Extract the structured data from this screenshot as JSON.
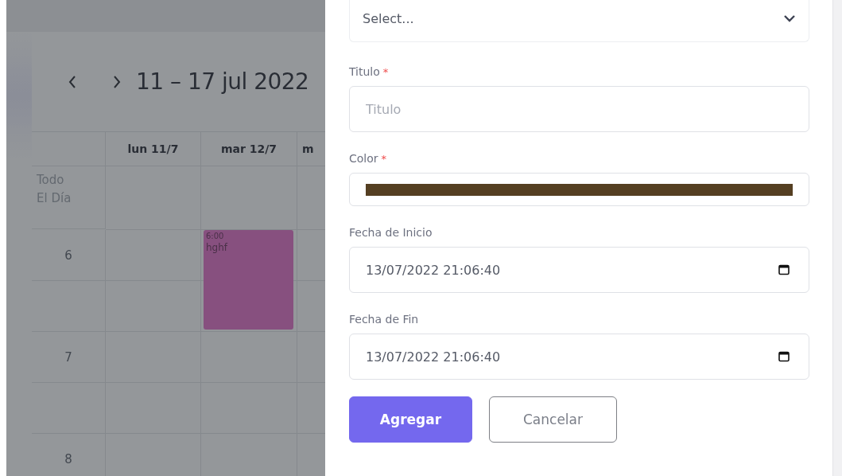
{
  "calendar": {
    "range_title": "11 – 17 jul 2022",
    "columns": [
      {
        "label": "lun 11/7"
      },
      {
        "label": "mar 12/7",
        "events": [
          {
            "time": "6:00",
            "title": "hghf",
            "color": "#87507f"
          }
        ]
      },
      {
        "label": "m"
      }
    ],
    "all_day_label": "Todo El Día",
    "hours": [
      "6",
      "7",
      "8"
    ]
  },
  "form": {
    "select": {
      "placeholder": "Select..."
    },
    "fields": [
      {
        "kind": "text",
        "label": "Titulo",
        "required_mark": "*",
        "placeholder": "Titulo"
      },
      {
        "kind": "color",
        "label": "Color",
        "required_mark": "*",
        "color": "#553f22"
      },
      {
        "kind": "datetime",
        "label": "Fecha de Inicio",
        "value": "13/07/2022 21:06:40"
      },
      {
        "kind": "datetime",
        "label": "Fecha de Fin",
        "value": "13/07/2022 21:06:40"
      }
    ],
    "buttons": [
      {
        "label": "Agregar",
        "primary": true
      },
      {
        "label": "Cancelar",
        "primary": false
      }
    ]
  }
}
